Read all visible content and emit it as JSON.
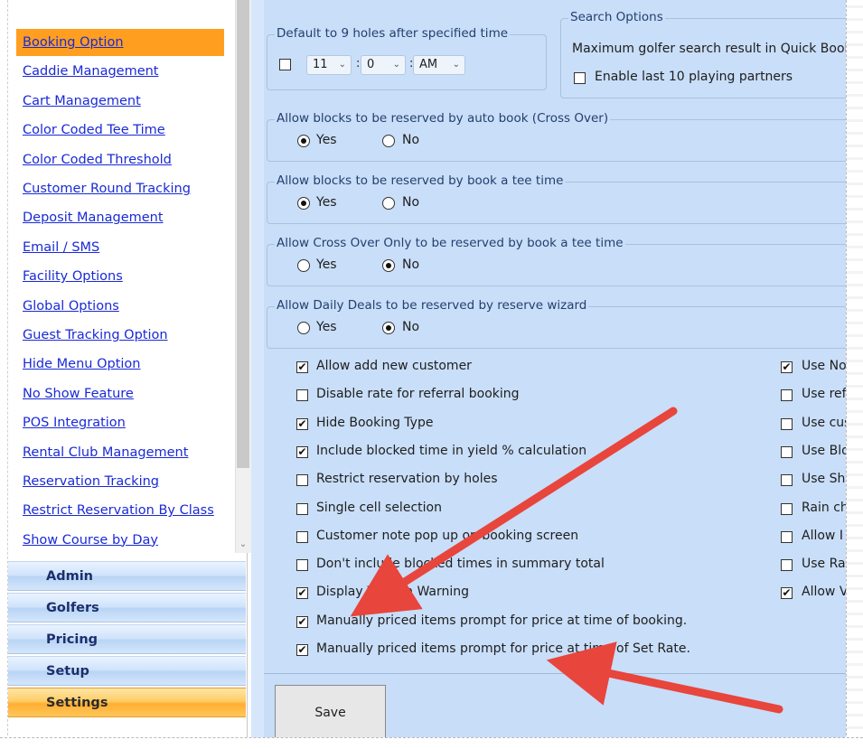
{
  "sidebar": {
    "partial_item": "",
    "items": [
      {
        "label": "Booking Option",
        "active": true
      },
      {
        "label": "Caddie Management"
      },
      {
        "label": "Cart Management"
      },
      {
        "label": "Color Coded Tee Time"
      },
      {
        "label": "Color Coded Threshold"
      },
      {
        "label": "Customer Round Tracking"
      },
      {
        "label": "Deposit Management"
      },
      {
        "label": "Email / SMS"
      },
      {
        "label": "Facility Options"
      },
      {
        "label": "Global Options"
      },
      {
        "label": "Guest Tracking Option"
      },
      {
        "label": "Hide Menu Option"
      },
      {
        "label": "No Show Feature"
      },
      {
        "label": "POS Integration"
      },
      {
        "label": "Rental Club Management"
      },
      {
        "label": "Reservation Tracking"
      },
      {
        "label": "Restrict Reservation By Class"
      },
      {
        "label": "Show Course by Day"
      }
    ],
    "groups": [
      {
        "label": "Admin"
      },
      {
        "label": "Golfers"
      },
      {
        "label": "Pricing"
      },
      {
        "label": "Setup"
      },
      {
        "label": "Settings",
        "active": true
      }
    ]
  },
  "main": {
    "default_9_holes": {
      "title": "Default to 9 holes after specified time",
      "checked": false,
      "hour": "11",
      "minute": "0",
      "ampm": "AM",
      "colon": ":"
    },
    "search_options": {
      "title": "Search Options",
      "max_result_label": "Maximum golfer search result in Quick Book",
      "last10_label": "Enable last 10 playing partners",
      "last10_checked": false
    },
    "radio_groups": [
      {
        "title": "Allow blocks to be reserved by auto book (Cross Over)",
        "yes": "Yes",
        "no": "No",
        "selected": "yes"
      },
      {
        "title": "Allow blocks to be reserved by book a tee time",
        "yes": "Yes",
        "no": "No",
        "selected": "yes"
      },
      {
        "title": "Allow Cross Over Only to be reserved by book a tee time",
        "yes": "Yes",
        "no": "No",
        "selected": "no"
      },
      {
        "title": "Allow Daily Deals to be reserved by reserve wizard",
        "yes": "Yes",
        "no": "No",
        "selected": "no"
      }
    ],
    "checkboxes_left": [
      {
        "label": "Allow add new customer",
        "checked": true
      },
      {
        "label": "Disable rate for referral booking",
        "checked": false
      },
      {
        "label": "Hide Booking Type",
        "checked": true
      },
      {
        "label": "Include blocked time in yield % calculation",
        "checked": true
      },
      {
        "label": "Restrict reservation by holes",
        "checked": false
      },
      {
        "label": "Single cell selection",
        "checked": false
      },
      {
        "label": "Customer note pop up on booking screen",
        "checked": false
      },
      {
        "label": "Don't include blocked times in summary total",
        "checked": false
      },
      {
        "label": "Display Walk In Warning",
        "checked": true
      },
      {
        "label": "Manually priced items prompt for price at time of booking.",
        "checked": true
      },
      {
        "label": "Manually priced items prompt for price at time of Set Rate.",
        "checked": true
      }
    ],
    "checkboxes_right": [
      {
        "label": "Use No",
        "checked": true
      },
      {
        "label": "Use refe",
        "checked": false
      },
      {
        "label": "Use cust",
        "checked": false
      },
      {
        "label": "Use Blo",
        "checked": false
      },
      {
        "label": "Use Sh",
        "checked": false
      },
      {
        "label": "Rain ch",
        "checked": false
      },
      {
        "label": "Allow I",
        "checked": false
      },
      {
        "label": "Use Ra",
        "checked": false
      },
      {
        "label": "Allow V",
        "checked": true
      }
    ],
    "save_label": "Save"
  },
  "colors": {
    "accent_orange": "#ff9e1f",
    "link_blue": "#1a2ad6",
    "panel_blue": "#c9def8",
    "arrow_red": "#e8453c"
  }
}
